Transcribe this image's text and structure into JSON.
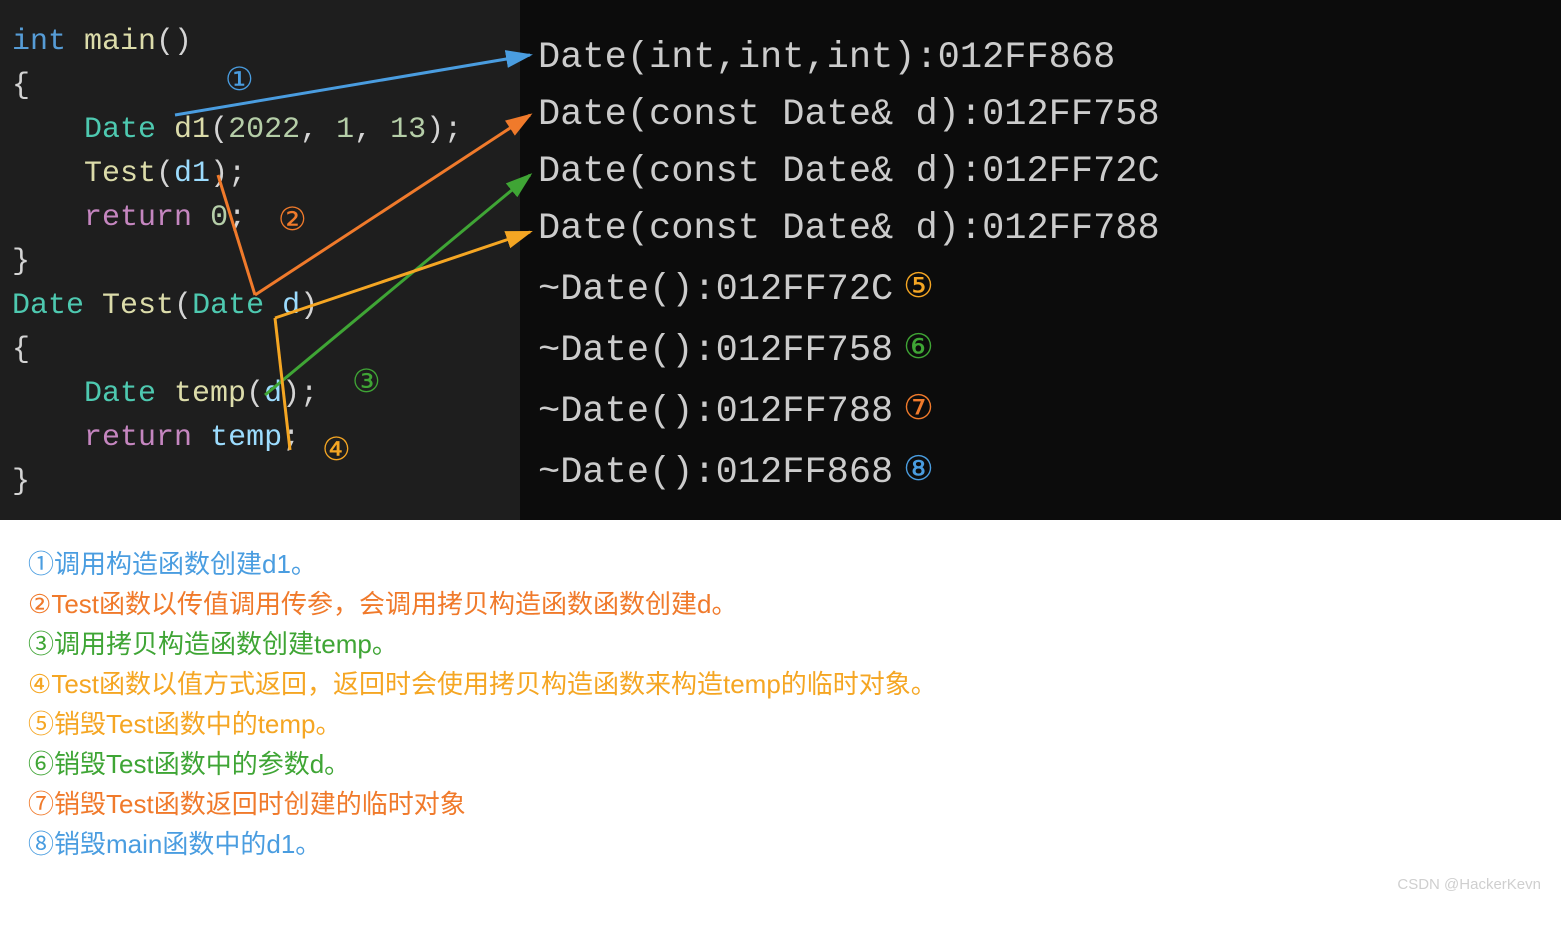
{
  "code": {
    "l1": {
      "kw": "int",
      "fn": " main",
      "punc1": "()"
    },
    "l2": "{",
    "l3": {
      "pad": "    ",
      "type": "Date",
      "sp": " ",
      "var": "d1",
      "args": "(",
      "n1": "2022",
      "c1": ", ",
      "n2": "1",
      "c2": ", ",
      "n3": "13",
      "end": ");"
    },
    "l4": {
      "pad": "    ",
      "fn": "Test",
      "args": "(",
      "var": "d1",
      "end": ");"
    },
    "l5": {
      "pad": "    ",
      "ret": "return",
      "sp": " ",
      "num": "0",
      "end": ";"
    },
    "l6": "}",
    "l7": {
      "type1": "Date",
      "sp1": " ",
      "fn": "Test",
      "p1": "(",
      "type2": "Date",
      "sp2": " ",
      "var": "d",
      "p2": ")"
    },
    "l8": "{",
    "l9": {
      "pad": "    ",
      "type": "Date",
      "sp": " ",
      "var": "temp",
      "p1": "(",
      "arg": "d",
      "p2": ");"
    },
    "l10": {
      "pad": "    ",
      "ret": "return",
      "sp": " ",
      "var": "temp",
      "end": ";"
    },
    "l11": "}"
  },
  "annotations": {
    "a1": "①",
    "a2": "②",
    "a3": "③",
    "a4": "④",
    "a5": "⑤",
    "a6": "⑥",
    "a7": "⑦",
    "a8": "⑧"
  },
  "output": {
    "o1": "Date(int,int,int):012FF868",
    "o2": "Date(const Date& d):012FF758",
    "o3": "Date(const Date& d):012FF72C",
    "o4": "Date(const Date& d):012FF788",
    "o5": "~Date():012FF72C",
    "o6": "~Date():012FF758",
    "o7": "~Date():012FF788",
    "o8": "~Date():012FF868"
  },
  "legend": {
    "l1": {
      "num": "①",
      "text": "调用构造函数创建d1。"
    },
    "l2": {
      "num": "②",
      "text": "Test函数以传值调用传参，会调用拷贝构造函数函数创建d。"
    },
    "l3": {
      "num": "③",
      "text": "调用拷贝构造函数创建temp。"
    },
    "l4": {
      "num": "④",
      "text": "Test函数以值方式返回，返回时会使用拷贝构造函数来构造temp的临时对象。"
    },
    "l5": {
      "num": "⑤",
      "text": "销毁Test函数中的temp。"
    },
    "l6": {
      "num": "⑥",
      "text": "销毁Test函数中的参数d。"
    },
    "l7": {
      "num": "⑦",
      "text": "销毁Test函数返回时创建的临时对象"
    },
    "l8": {
      "num": "⑧",
      "text": "销毁main函数中的d1。"
    }
  },
  "colors": {
    "blue": "#4a9de0",
    "orange_dark": "#f07a2b",
    "green": "#3fa535",
    "orange_light": "#f5a623"
  },
  "watermark": "CSDN @HackerKevn",
  "chart_data": {
    "type": "table",
    "title": "C++ constructor/destructor call trace with pass-by-value",
    "series": [
      {
        "step": 1,
        "event": "Date(int,int,int)",
        "address": "012FF868",
        "meaning": "构造 d1",
        "color": "blue"
      },
      {
        "step": 2,
        "event": "Date(const Date& d)",
        "address": "012FF758",
        "meaning": "拷贝构造参数 d",
        "color": "orange_dark"
      },
      {
        "step": 3,
        "event": "Date(const Date& d)",
        "address": "012FF72C",
        "meaning": "拷贝构造 temp",
        "color": "green"
      },
      {
        "step": 4,
        "event": "Date(const Date& d)",
        "address": "012FF788",
        "meaning": "拷贝构造返回临时对象",
        "color": "orange_light"
      },
      {
        "step": 5,
        "event": "~Date()",
        "address": "012FF72C",
        "meaning": "销毁 temp",
        "color": "orange_light"
      },
      {
        "step": 6,
        "event": "~Date()",
        "address": "012FF758",
        "meaning": "销毁参数 d",
        "color": "green"
      },
      {
        "step": 7,
        "event": "~Date()",
        "address": "012FF788",
        "meaning": "销毁返回临时对象",
        "color": "orange_dark"
      },
      {
        "step": 8,
        "event": "~Date()",
        "address": "012FF868",
        "meaning": "销毁 d1",
        "color": "blue"
      }
    ]
  }
}
